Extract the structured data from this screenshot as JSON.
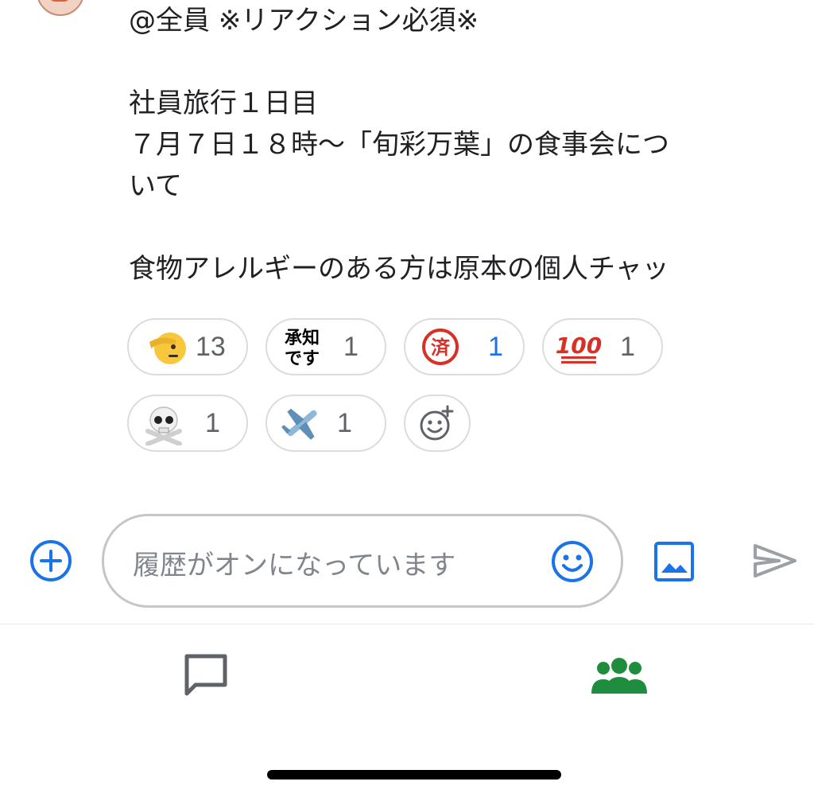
{
  "message": {
    "lines": [
      "@全員 ※リアクション必須※",
      "",
      "社員旅行１日目",
      "７月７日１８時〜「旬彩万葉」の食事会につ",
      "いて",
      "",
      "食物アレルギーのある方は原本の個人チャッ"
    ]
  },
  "reactions": [
    {
      "name": "saluting-face",
      "count": "13"
    },
    {
      "name": "shouchi-desu",
      "text": "承知\nです",
      "count": "1"
    },
    {
      "name": "sumi-stamp",
      "text": "済",
      "count": "1",
      "count_color": "#1a73e8"
    },
    {
      "name": "hundred-points",
      "text": "100",
      "count": "1"
    },
    {
      "name": "skull-and-crossbones",
      "count": "1"
    },
    {
      "name": "airplane",
      "count": "1"
    }
  ],
  "composer": {
    "placeholder": "履歴がオンになっています"
  },
  "colors": {
    "accent_blue": "#1a73e8",
    "nav_green": "#1e8e3e",
    "text": "#202124",
    "muted": "#5f6368",
    "chip_border": "#dadce0"
  }
}
